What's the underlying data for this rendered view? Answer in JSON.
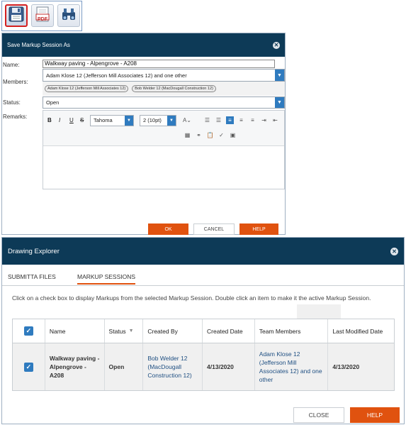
{
  "toolbar": {
    "save_icon": "floppy-disk-icon",
    "pdf_label": "PDF",
    "find_icon": "binoculars-icon"
  },
  "save_dialog": {
    "title": "Save Markup Session As",
    "name_label": "Name:",
    "name_value": "Walkway paving - Alpengrove - A208",
    "members_label": "Members:",
    "members_value": "Adam Klose 12 (Jefferson Mill Associates 12) and one other",
    "member_chips": [
      "Adam Klose 12 (Jefferson Mill Associates 12)",
      "Bob Welder 12 (MacDougall Construction 12)"
    ],
    "status_label": "Status:",
    "status_value": "Open",
    "remarks_label": "Remarks:",
    "editor": {
      "bold": "B",
      "italic": "I",
      "underline": "U",
      "strike": "S",
      "font": "Tahoma",
      "size": "2 (10pt)"
    },
    "ok_label": "OK",
    "cancel_label": "CANCEL",
    "help_label": "HELP"
  },
  "explorer": {
    "title": "Drawing Explorer",
    "tabs": [
      "SUBMITTA FILES",
      "MARKUP SESSIONS"
    ],
    "instructions": "Click on a check box to display Markups from the selected Markup Session. Double click an item to make it the active Markup Session.",
    "columns": [
      "Name",
      "Status",
      "Created By",
      "Created Date",
      "Team Members",
      "Last Modified Date"
    ],
    "rows": [
      {
        "name": "Walkway paving - Alpengrove - A208",
        "status": "Open",
        "created_by": "Bob Welder 12 (MacDougall Construction 12)",
        "created_date": "4/13/2020",
        "team_members": "Adam Klose 12 (Jefferson Mill Associates 12) and one other",
        "last_modified": "4/13/2020"
      }
    ],
    "close_label": "CLOSE",
    "help_label": "HELP"
  },
  "colors": {
    "header": "#0d3a57",
    "accent_orange": "#e0520f",
    "accent_blue": "#2f7bbf"
  }
}
